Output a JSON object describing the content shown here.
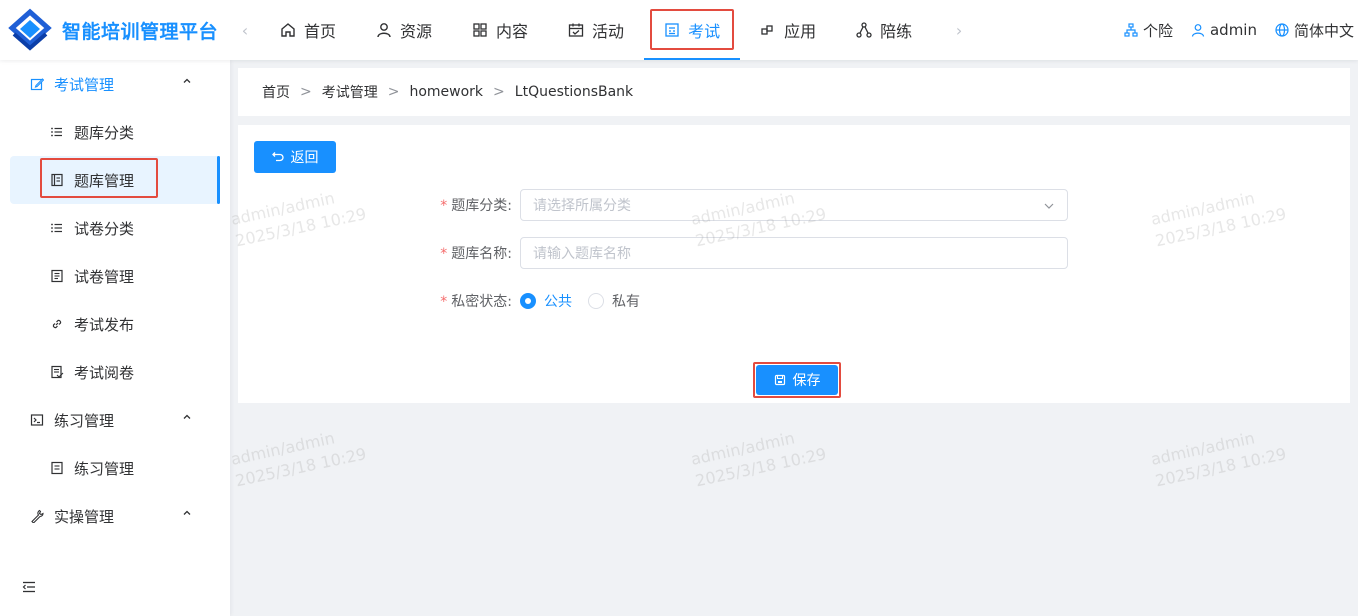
{
  "app": {
    "title": "智能培训管理平台"
  },
  "header": {
    "nav_prev": "‹",
    "nav_next": "›",
    "nav": [
      {
        "label": "首页",
        "icon": "home-icon"
      },
      {
        "label": "资源",
        "icon": "user-icon"
      },
      {
        "label": "内容",
        "icon": "grid-icon"
      },
      {
        "label": "活动",
        "icon": "calendar-icon"
      },
      {
        "label": "考试",
        "icon": "exam-icon",
        "active": true
      },
      {
        "label": "应用",
        "icon": "apps-icon"
      },
      {
        "label": "陪练",
        "icon": "network-icon"
      }
    ],
    "right": {
      "org": "个险",
      "user": "admin",
      "lang": "简体中文"
    }
  },
  "sidebar": {
    "groups": [
      {
        "label": "考试管理",
        "icon": "edit-icon",
        "open": true
      },
      {
        "label": "练习管理",
        "icon": "terminal-icon"
      },
      {
        "label": "实操管理",
        "icon": "wrench-icon"
      }
    ],
    "exam_items": [
      {
        "label": "题库分类",
        "icon": "list-icon"
      },
      {
        "label": "题库管理",
        "icon": "book-icon",
        "active": true
      },
      {
        "label": "试卷分类",
        "icon": "list-icon"
      },
      {
        "label": "试卷管理",
        "icon": "paper-icon"
      },
      {
        "label": "考试发布",
        "icon": "link-icon"
      },
      {
        "label": "考试阅卷",
        "icon": "review-icon"
      }
    ],
    "practice_items": [
      {
        "label": "练习管理",
        "icon": "doc-icon"
      }
    ]
  },
  "breadcrumb": [
    "首页",
    "考试管理",
    "homework",
    "LtQuestionsBank"
  ],
  "form": {
    "back_label": "返回",
    "category_label": "题库分类:",
    "category_placeholder": "请选择所属分类",
    "name_label": "题库名称:",
    "name_placeholder": "请输入题库名称",
    "privacy_label": "私密状态:",
    "privacy_options": [
      "公共",
      "私有"
    ],
    "privacy_selected": "公共",
    "save_label": "保存"
  },
  "watermark": {
    "user": "admin/admin",
    "time": "2025/3/18 10:29"
  },
  "colors": {
    "primary": "#1890ff",
    "highlight": "#e34b3f",
    "required": "#f56c6c"
  }
}
